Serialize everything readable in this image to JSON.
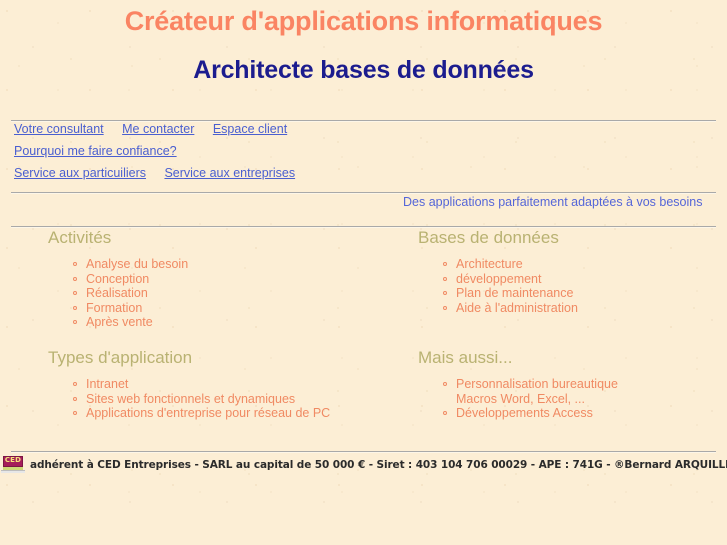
{
  "header": {
    "title_main": "Créateur d'applications informatiques",
    "title_sub": "Architecte bases de données",
    "title_main_color": "#fa8463",
    "title_sub_color": "#1c1c8e"
  },
  "nav": {
    "rows": [
      [
        {
          "label": "Votre consultant"
        },
        {
          "label": "Me contacter"
        },
        {
          "label": "Espace client"
        }
      ],
      [
        {
          "label": "Pourquoi me faire confiance?"
        }
      ],
      [
        {
          "label": "Service aux particuiliers"
        },
        {
          "label": "Service aux entreprises"
        }
      ]
    ],
    "link_color": "#4a5fd0"
  },
  "tagline": {
    "text": "Des applications parfaitement adaptées à vos besoins",
    "color": "#5566d8"
  },
  "sections": {
    "heading_color": "#b9b272",
    "item_color": "#f08a63",
    "activites": {
      "heading": "Activités",
      "items": [
        {
          "label": "Analyse du besoin"
        },
        {
          "label": "Conception"
        },
        {
          "label": "Réalisation"
        },
        {
          "label": "Formation"
        },
        {
          "label": "Après vente"
        }
      ]
    },
    "bases_de_donnees": {
      "heading": "Bases de données",
      "items": [
        {
          "label": "Architecture"
        },
        {
          "label": "développement"
        },
        {
          "label": "Plan de maintenance"
        },
        {
          "label": "Aide à l'administration"
        }
      ]
    },
    "types_application": {
      "heading": "Types d'application",
      "items": [
        {
          "label": "Intranet"
        },
        {
          "label": "Sites web fonctionnels et dynamiques"
        },
        {
          "label": "Applications d'entreprise pour réseau de PC"
        }
      ]
    },
    "mais_aussi": {
      "heading": "Mais aussi...",
      "items": [
        {
          "label": "Personnalisation bureautique",
          "sub": "Macros Word, Excel, ..."
        },
        {
          "label": "Développements Access"
        }
      ]
    }
  },
  "footer": {
    "logo_text": "CED",
    "text": "adhérent à CED Entreprises - SARL au capital de 50 000 € - Siret : 403 104 706 00029 - APE : 741G  -  ®Bernard ARQUILLIERE"
  },
  "background_color": "#fceed5"
}
